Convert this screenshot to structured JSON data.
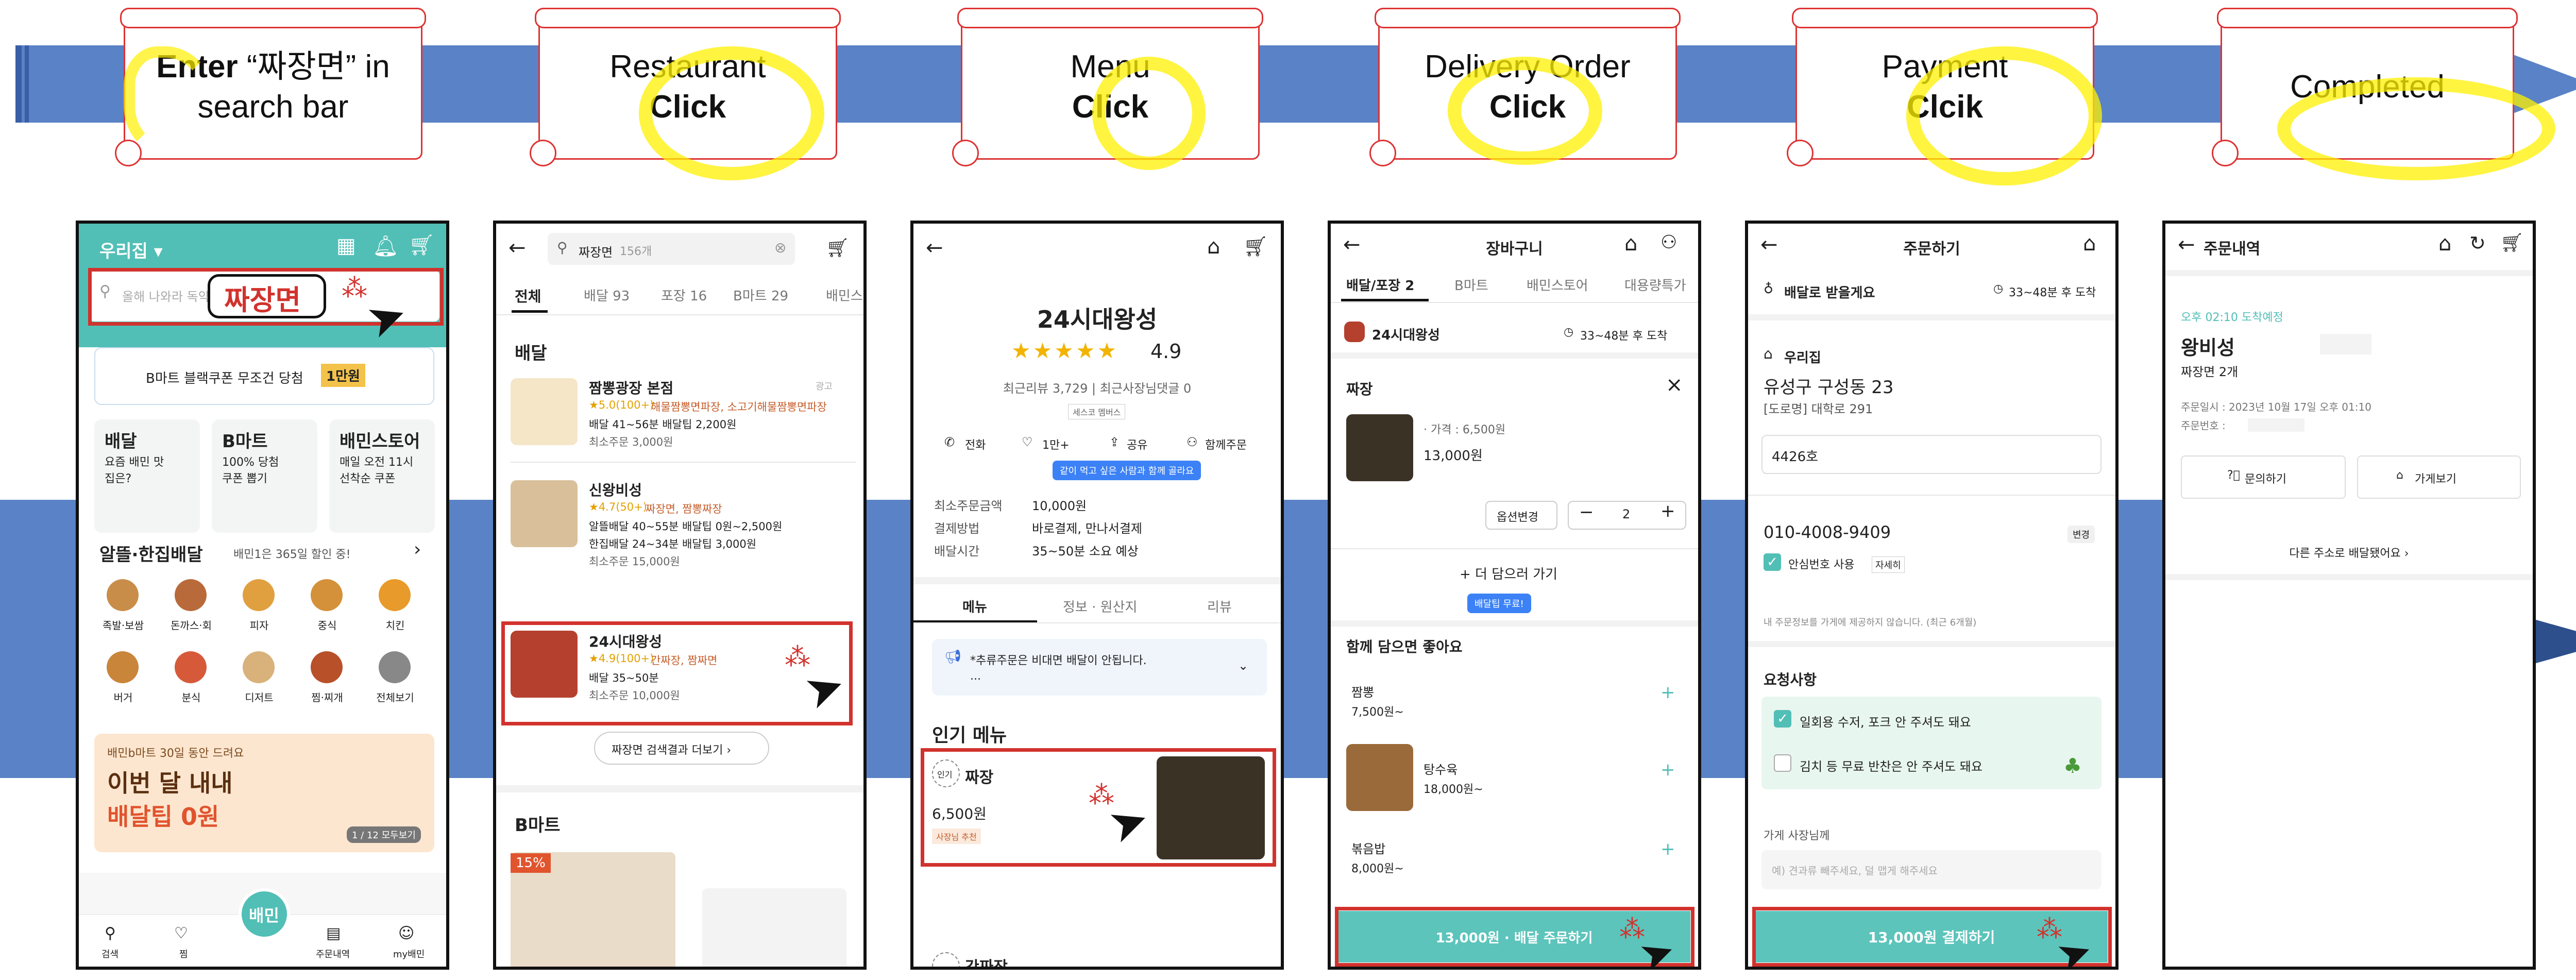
{
  "steps": [
    {
      "line1_bold": "Enter",
      "line1_rest": " “짜장면” in",
      "line2": "search bar"
    },
    {
      "line1": "Restaurant",
      "line2_bold": "Click"
    },
    {
      "line1": "Menu",
      "line2_bold": "Click"
    },
    {
      "line1": "Delivery Order",
      "line2_bold": "Click"
    },
    {
      "line1": "Payment",
      "line2_bold": "Clcik"
    },
    {
      "line1": "Completed"
    }
  ],
  "s1": {
    "location": "우리집 ▾",
    "search_placeholder": "올해 나와라 독약",
    "search_value": "짜장면",
    "banner": "B마트 블랙쿠폰 무조건 당첨",
    "banner_badge": "1만원",
    "cards": [
      {
        "title": "배달",
        "sub": "요즘 배민 맛집은?"
      },
      {
        "title": "B마트",
        "sub": "100% 당첨 쿠폰 뽑기"
      },
      {
        "title": "배민스토어",
        "sub": "매일 오전 11시 선착순 쿠폰"
      }
    ],
    "section_title": "알뜰·한집배달",
    "section_sub": "배민1은 365일 할인 중!",
    "cats": [
      "족발·보쌈",
      "돈까스·회",
      "피자",
      "중식",
      "치킨",
      "버거",
      "분식",
      "디저트",
      "찜·찌개",
      "전체보기"
    ],
    "promo_small": "배민b마트 30일 동안 드려요",
    "promo_l1": "이번 달 내내",
    "promo_l2": "배달팁 0원",
    "promo_page": "1 / 12 모두보기",
    "nav": [
      "검색",
      "찜",
      "배민",
      "주문내역",
      "my배민"
    ]
  },
  "s2": {
    "search": "짜장면",
    "count": "156개",
    "tabs": [
      "전체",
      "배달 93",
      "포장 16",
      "B마트 29",
      "배민스"
    ],
    "section": "배달",
    "items": [
      {
        "name": "짬뽕광장 본점",
        "ad": "광고",
        "rating": "★5.0(100+)",
        "menu": "해물짬뽕면파장, 소고기해물짬뽕면파장",
        "tip": "배달 41~56분  배달팁 2,200원",
        "min": "최소주문 3,000원"
      },
      {
        "name": "신왕비성",
        "ad": "",
        "rating": "★4.7(50+)",
        "menu": "짜장면, 짬뽕짜장",
        "tip": "알뜰배달  40~55분  배달팁 0원~2,500원",
        "tip2": "한집배달  24~34분  배달팁 3,000원",
        "min": "최소주문 15,000원"
      },
      {
        "name": "24시대왕성",
        "ad": "",
        "rating": "★4.9(100+)",
        "menu": "간짜장, 짬짜면",
        "tip": "배달 35~50분",
        "min": "최소주문 10,000원"
      }
    ],
    "more": "짜장면 검색결과 더보기 ›",
    "section2": "B마트",
    "badge": "15%"
  },
  "s3": {
    "store": "24시대왕성",
    "rating": "4.9",
    "reviews": "최근리뷰 3,729  |  최근사장님댓글 0",
    "tag": "세스코 멤버스",
    "actions": [
      "전화",
      "1만+",
      "공유",
      "함께주문"
    ],
    "tooltip": "같이 먹고 싶은 사람과 함께 골라요",
    "info_labels": [
      "최소주문금액",
      "결제방법",
      "배달시간"
    ],
    "info_values": [
      "10,000원",
      "바로결제, 만나서결제",
      "35~50분 소요 예상"
    ],
    "tabs": [
      "메뉴",
      "정보 · 원산지",
      "리뷰"
    ],
    "notice": "*추류주문은 비대면 배달이 안됩니다.",
    "notice2": "...",
    "popular": "인기 메뉴",
    "menu_badge": "인기",
    "menu_name": "짜장",
    "menu_price": "6,500원",
    "menu_tag": "사장님 추천",
    "next_menu": "간짜장"
  },
  "s4": {
    "title": "장바구니",
    "tabs": [
      "배달/포장 2",
      "B마트",
      "배민스토어",
      "대용량특가"
    ],
    "store": "24시대왕성",
    "eta": "33~48분 후 도착",
    "item": "짜장",
    "price_line": "· 가격 : 6,500원",
    "price": "13,000원",
    "option_btn": "옵션변경",
    "qty": "2",
    "add_more": "+ 더 담으러 가기",
    "free_tip": "배달팁 무료!",
    "rec_title": "함께 담으면 좋아요",
    "recs": [
      {
        "name": "짬뽕",
        "price": "7,500원~"
      },
      {
        "name": "탕수육",
        "price": "18,000원~"
      },
      {
        "name": "볶음밥",
        "price": "8,000원~"
      }
    ],
    "order_btn": "13,000원 · 배달 주문하기"
  },
  "s5": {
    "title": "주문하기",
    "delivery": "배달로 받을게요",
    "eta": "33~48분 후 도착",
    "addr_label": "우리집",
    "addr1": "유성구 구성동 23",
    "addr2": "[도로명] 대학로 291",
    "room": "4426호",
    "phone": "010-4008-9409",
    "change": "변경",
    "safe": "안심번호 사용",
    "safe_detail": "자세히",
    "notice": "내 주문정보를 가게에 제공하지 않습니다. (최근 6개월)",
    "req_title": "요청사항",
    "req1": "일회용 수저, 포크 안 주셔도 돼요",
    "req2": "김치 등 무료 반찬은 안 주셔도 돼요",
    "owner_label": "가게 사장님께",
    "owner_placeholder": "예) 견과류 빼주세요, 덜 맵게 해주세요",
    "pay_btn": "13,000원 결제하기"
  },
  "s6": {
    "title": "주문내역",
    "time": "오후 02:10 도착예정",
    "store": "왕비성",
    "menu": "짜장면 2개",
    "date": "주문일시 : 2023년 10월 17일 오후 01:10",
    "orderno": "주문번호 :",
    "btn1": "문의하기",
    "btn2": "가게보기",
    "other": "다른 주소로 배달됐어요 ›"
  },
  "colors": {
    "teal": "#52bfb6",
    "red": "#d2322d",
    "blue_arrow": "#5a82c6",
    "highlight": "#fff000"
  }
}
